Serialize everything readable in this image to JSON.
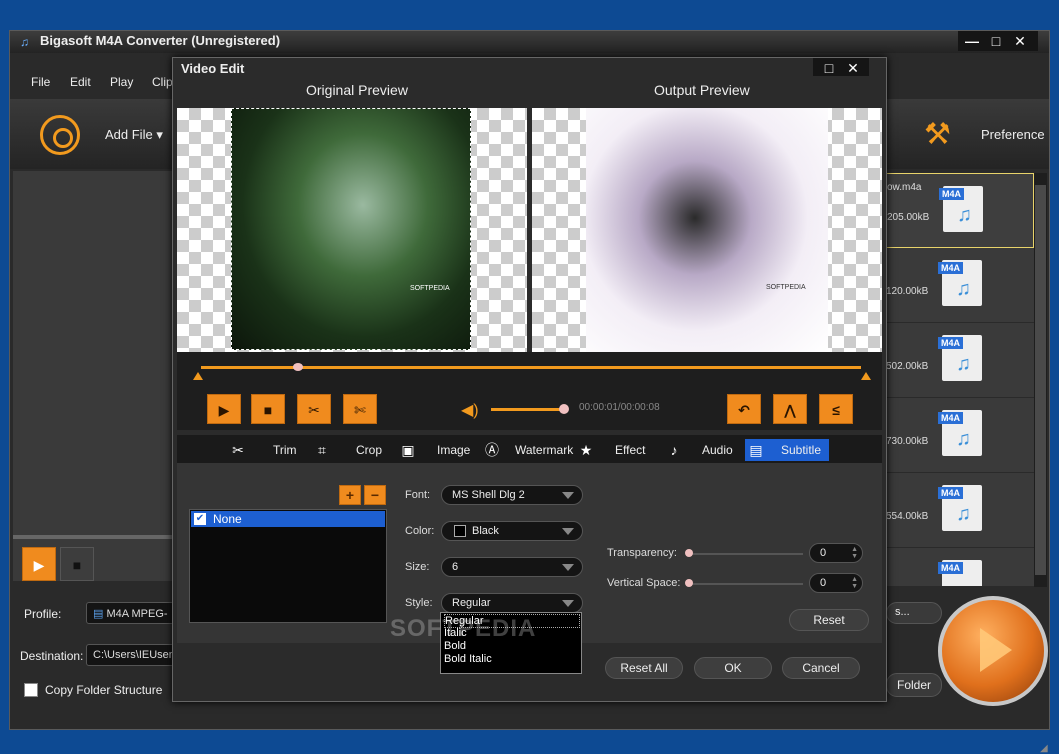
{
  "main": {
    "title": "Bigasoft M4A Converter (Unregistered)",
    "controls": {
      "minimize": "—",
      "maximize": "□",
      "close": "✕"
    },
    "menu": [
      "File",
      "Edit",
      "Play",
      "Clip"
    ],
    "toolbar": {
      "add_file": "Add File",
      "preference": "Preference"
    },
    "files": [
      {
        "name": "ow.m4a",
        "size": "205.00kB"
      },
      {
        "name": "",
        "size": "120.00kB"
      },
      {
        "name": "",
        "size": "502.00kB"
      },
      {
        "name": "",
        "size": "730.00kB"
      },
      {
        "name": "",
        "size": "554.00kB"
      },
      {
        "name": "",
        "size": ""
      }
    ],
    "file_tag": "M4A",
    "profile": {
      "label": "Profile:",
      "value": "M4A MPEG-",
      "button": "s..."
    },
    "destination": {
      "label": "Destination:",
      "value": "C:\\Users\\IEUser",
      "button": "Folder"
    },
    "copy_folder_structure": "Copy Folder Structure"
  },
  "dialog": {
    "title": "Video Edit",
    "controls": {
      "maximize": "□",
      "close": "✕"
    },
    "original_preview": "Original Preview",
    "output_preview": "Output Preview",
    "video_watermark": "SOFTPEDIA",
    "time": "00:00:01/00:00:08",
    "tabs": [
      "Trim",
      "Crop",
      "Image",
      "Watermark",
      "Effect",
      "Audio",
      "Subtitle"
    ],
    "active_tab": "Subtitle",
    "subtitle": {
      "list": [
        {
          "label": "None",
          "checked": true
        }
      ],
      "font_label": "Font:",
      "font_value": "MS Shell Dlg 2",
      "color_label": "Color:",
      "color_value": "Black",
      "color_hex": "#000000",
      "size_label": "Size:",
      "size_value": "6",
      "style_label": "Style:",
      "style_value": "Regular",
      "style_options": [
        "Regular",
        "Italic",
        "Bold",
        "Bold Italic"
      ],
      "transparency_label": "Transparency:",
      "transparency_value": "0",
      "vertical_space_label": "Vertical Space:",
      "vertical_space_value": "0",
      "reset": "Reset"
    },
    "buttons": {
      "reset_all": "Reset All",
      "ok": "OK",
      "cancel": "Cancel"
    }
  },
  "overlay_watermark": "SOFTPEDIA",
  "colors": {
    "accent": "#f08b1e",
    "selection": "#1d5fd1",
    "desktop": "#0d4a93"
  }
}
